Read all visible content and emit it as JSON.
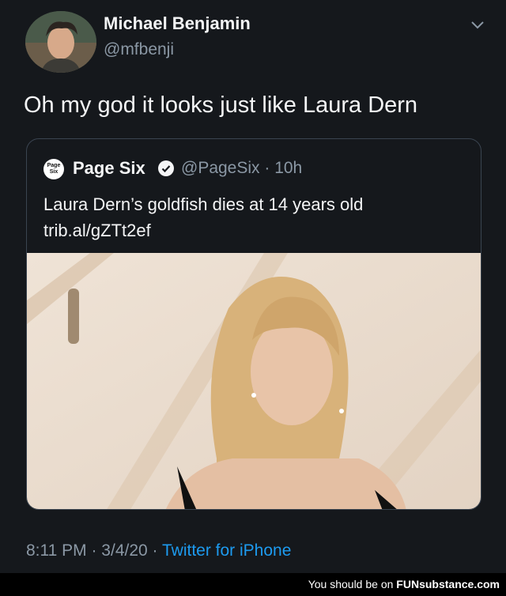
{
  "tweet": {
    "author_name": "Michael Benjamin",
    "author_handle": "@mfbenji",
    "text": "Oh my god it looks just like Laura Dern",
    "quoted": {
      "logo_text": "Page Six",
      "name": "Page Six",
      "handle_time": "@PageSix · 10h",
      "text": "Laura Dern’s goldfish dies at 14 years old trib.al/gZTt2ef"
    },
    "timestamp": "8:11 PM · 3/4/20 · ",
    "source": "Twitter for iPhone"
  },
  "footer": {
    "text": "You should be on ",
    "brand": "FUNsubstance.com"
  },
  "colors": {
    "background": "#15181c",
    "link": "#1d9bf0",
    "secondary_text": "#8b98a5"
  }
}
